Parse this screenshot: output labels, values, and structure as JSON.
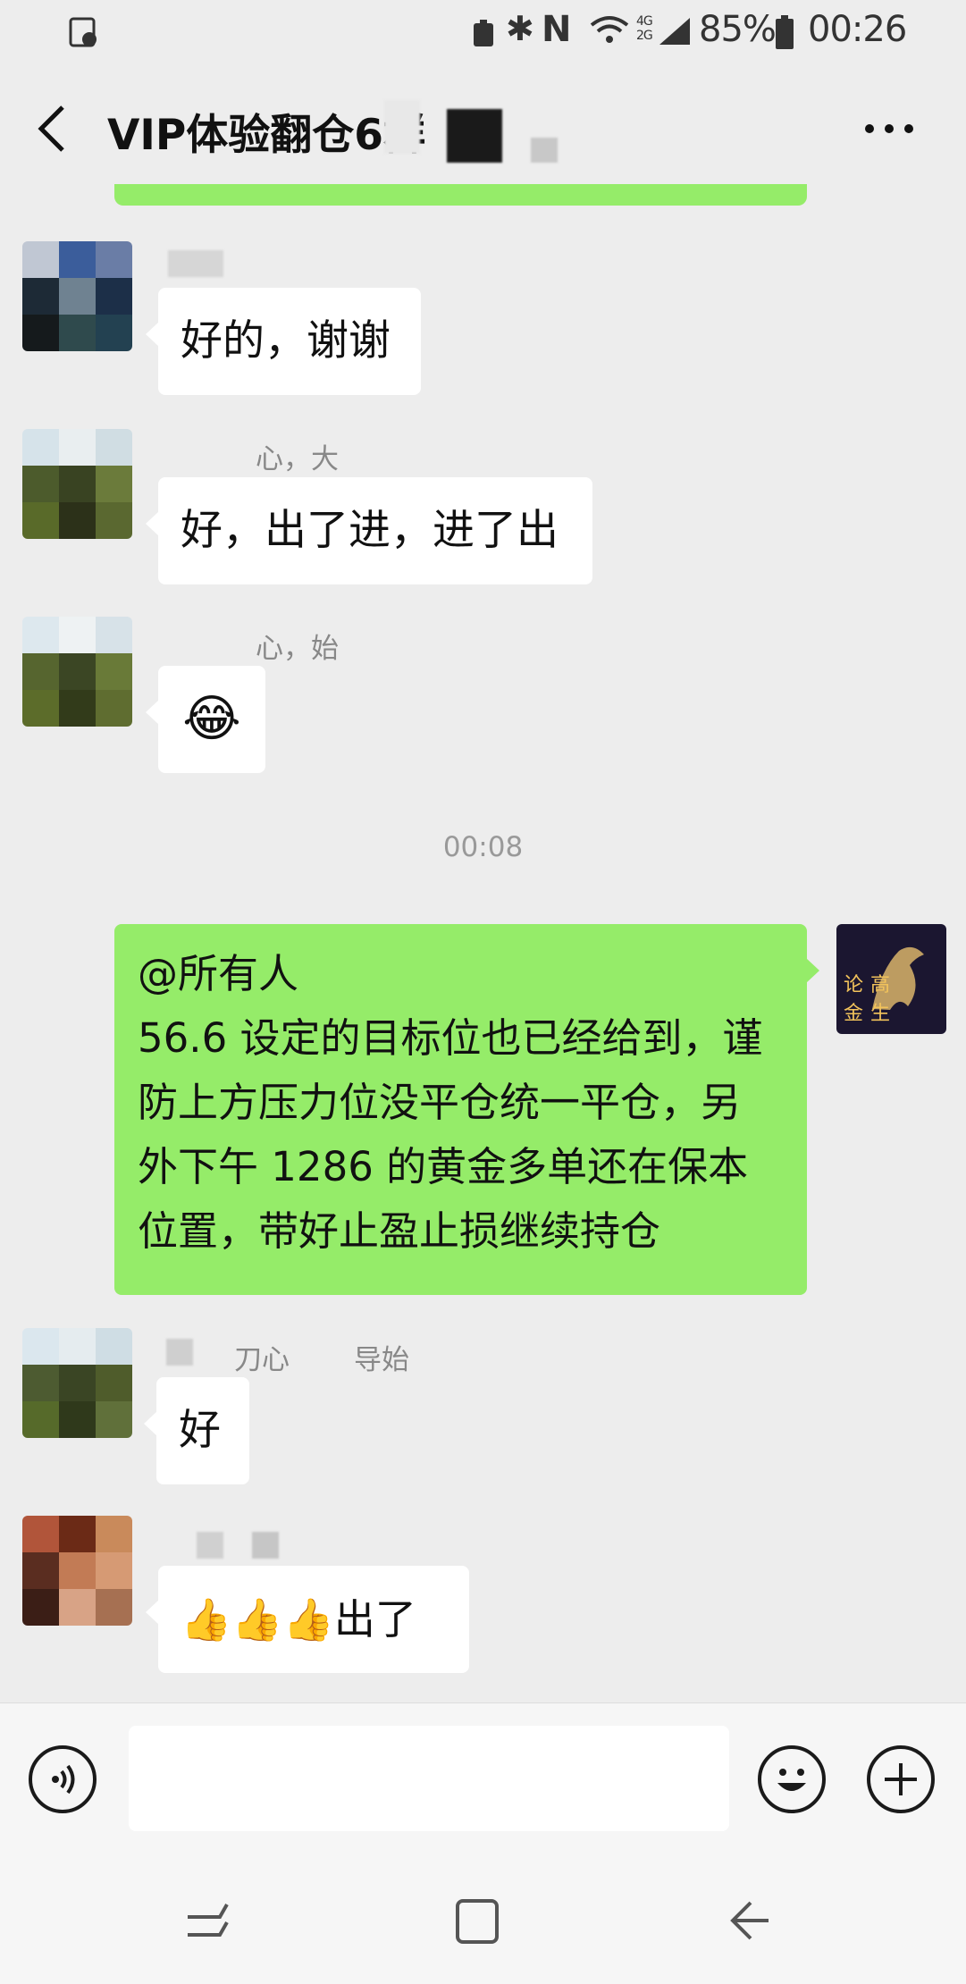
{
  "status_bar": {
    "battery": "85%",
    "time": "00:26",
    "network": "4G 2G"
  },
  "header": {
    "title": "VIP体验翻仓6群"
  },
  "messages": [
    {
      "sender": "",
      "text": "好的，谢谢"
    },
    {
      "sender": "心，大",
      "text": "好，出了进，进了出"
    },
    {
      "sender": "心，始",
      "text": "😂"
    },
    {
      "time": "00:08"
    },
    {
      "self": true,
      "mention": "@所有人",
      "text_lines": [
        "56.6 设定的目标位也已经给到，谨",
        "防上方压力位没平仓统一平仓，另",
        "外下午 1286 的黄金多单还在保本",
        "位置，带好止盈止损继续持仓"
      ],
      "avatar_text": [
        "论",
        "高",
        "金",
        "生"
      ]
    },
    {
      "sender": "刀心",
      "sender2": "导始",
      "text": "好"
    },
    {
      "sender": "",
      "text": "👍👍👍出了"
    }
  ],
  "input": {
    "placeholder": ""
  },
  "colors": {
    "self_bubble": "#95ec69",
    "bg": "#ededed"
  }
}
